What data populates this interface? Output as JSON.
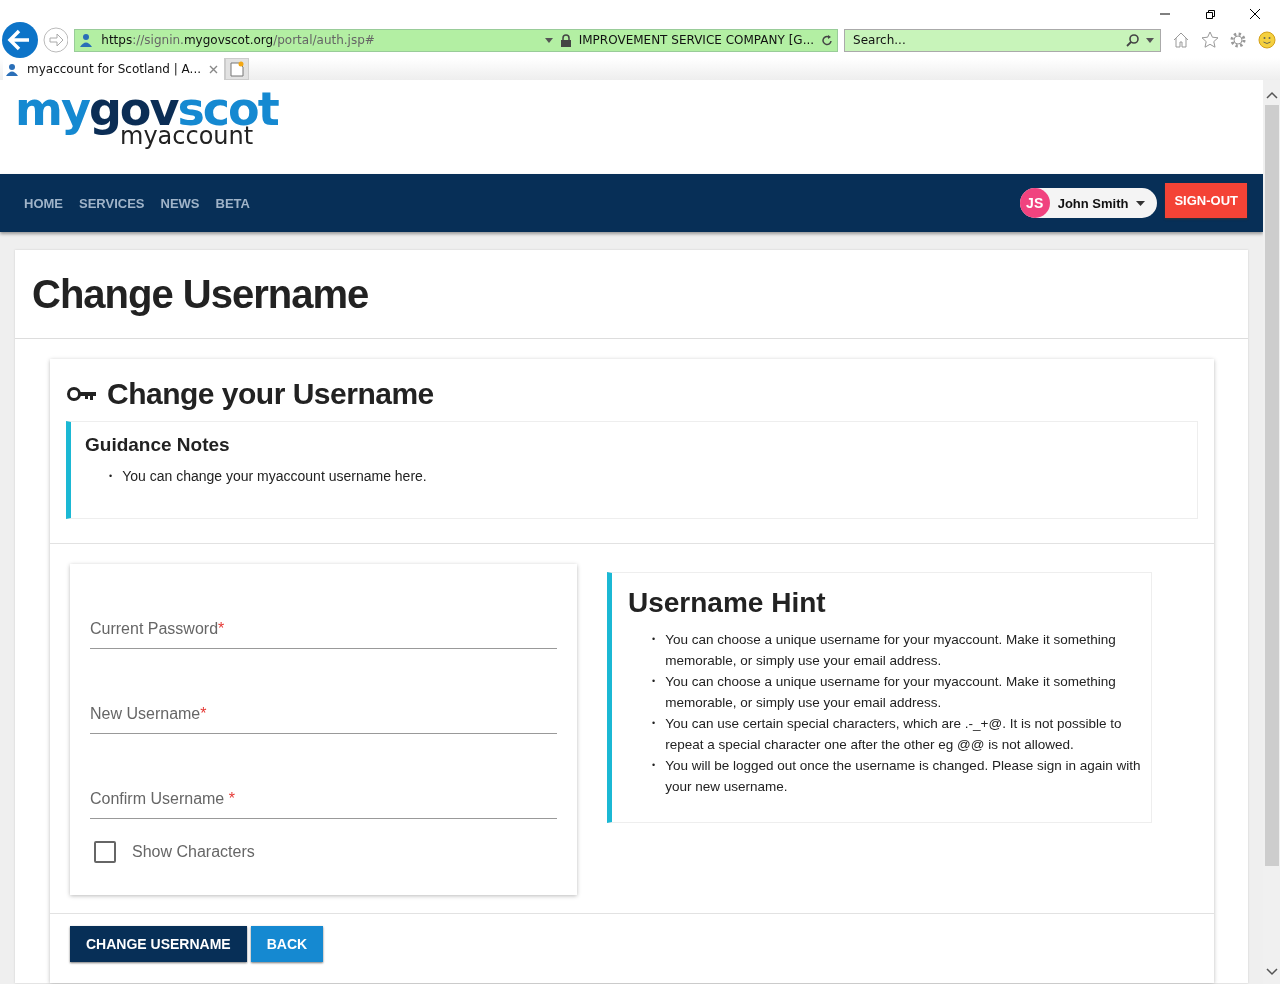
{
  "browser": {
    "url": [
      {
        "text": "https",
        "kind": "strong"
      },
      {
        "text": "://signin.",
        "kind": "dim"
      },
      {
        "text": "mygovscot.org",
        "kind": "strong"
      },
      {
        "text": "/portal/auth.jsp#",
        "kind": "dim"
      }
    ],
    "certificate": "IMPROVEMENT SERVICE COMPANY [G...",
    "search": {
      "placeholder": "Search..."
    },
    "tabs": [
      {
        "label": "myaccount for Scotland | A...",
        "selected": true
      }
    ]
  },
  "logo": {
    "parts": [
      {
        "text": "my",
        "kind": "light"
      },
      {
        "text": "gov",
        "kind": "dark"
      },
      {
        "text": "scot",
        "kind": "light"
      }
    ],
    "subtitle": "myaccount"
  },
  "nav": {
    "items": [
      {
        "label": "HOME"
      },
      {
        "label": "SERVICES"
      },
      {
        "label": "NEWS"
      },
      {
        "label": "BETA"
      }
    ],
    "user": {
      "initials": "JS",
      "name": "John Smith"
    },
    "sign_out": "SIGN-OUT"
  },
  "page_title": "Change Username",
  "card": {
    "title": "Change your Username",
    "guidance": {
      "title": "Guidance Notes",
      "bullet": "•",
      "items": [
        "You can change your myaccount username here."
      ]
    },
    "fields": [
      {
        "label": "Current Password",
        "mark": "*"
      },
      {
        "label": "New Username",
        "mark": "*"
      },
      {
        "label": "Confirm Username",
        "mark": " *"
      }
    ],
    "show_characters": {
      "label": "Show Characters",
      "checked": false
    },
    "hint": {
      "title": "Username Hint",
      "bullet": "•",
      "items": [
        "You can choose a unique username for your myaccount. Make it something memorable, or simply use your email address.",
        "You can choose a unique username for your myaccount. Make it something memorable, or simply use your email address.",
        "You can use certain special characters, which are .-_+@. It is not possible to repeat a special character one after the other eg @@ is not allowed.",
        "You will be logged out once the username is changed. Please sign in again with your new username."
      ]
    },
    "buttons": [
      {
        "label": "CHANGE USERNAME",
        "kind": "primary"
      },
      {
        "label": "BACK",
        "kind": "secondary"
      }
    ]
  }
}
